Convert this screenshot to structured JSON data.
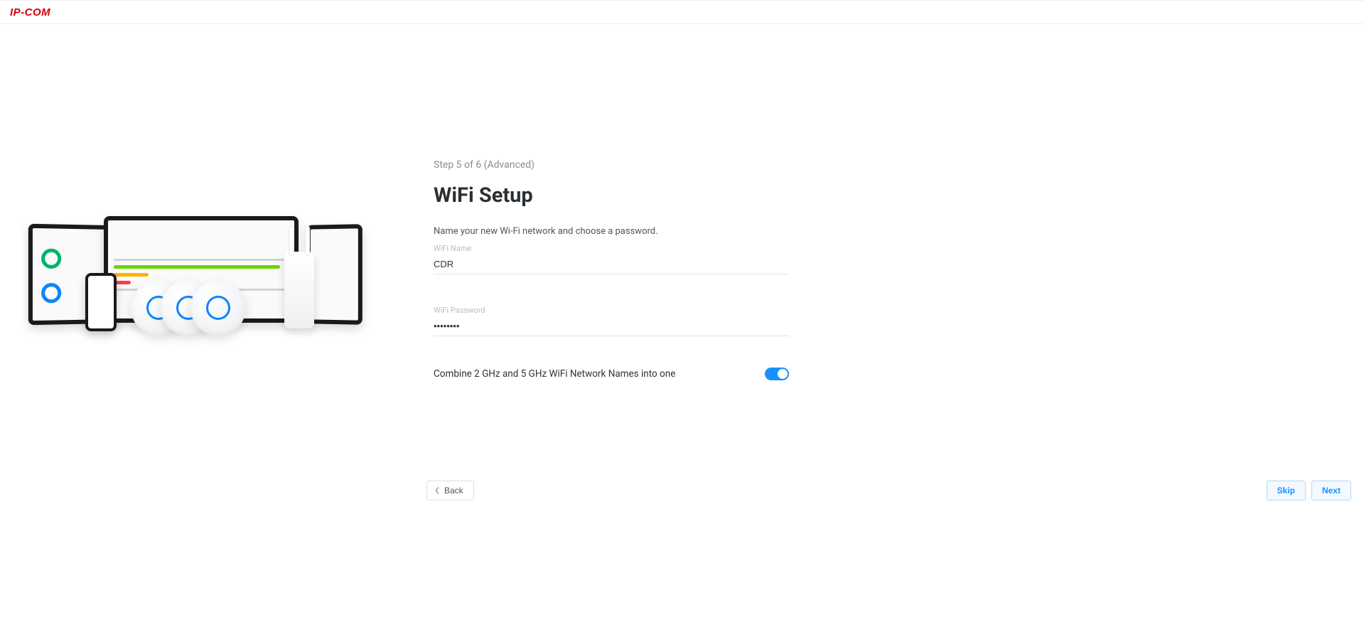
{
  "header": {
    "logo_text": "IP-COM"
  },
  "step": {
    "label": "Step 5 of 6  (Advanced)"
  },
  "page": {
    "title": "WiFi Setup",
    "hint": "Name your new Wi-Fi network and choose a password."
  },
  "form": {
    "wifi_name": {
      "label": "WiFi Name",
      "value": "CDR"
    },
    "wifi_password": {
      "label": "WiFi Password",
      "value": "••••••••"
    },
    "combine": {
      "label": "Combine 2 GHz and 5 GHz WiFi Network Names into one",
      "enabled": true
    }
  },
  "actions": {
    "back": "Back",
    "skip": "Skip",
    "next": "Next"
  },
  "colors": {
    "brand_red": "#d40010",
    "primary": "#1890ff"
  }
}
